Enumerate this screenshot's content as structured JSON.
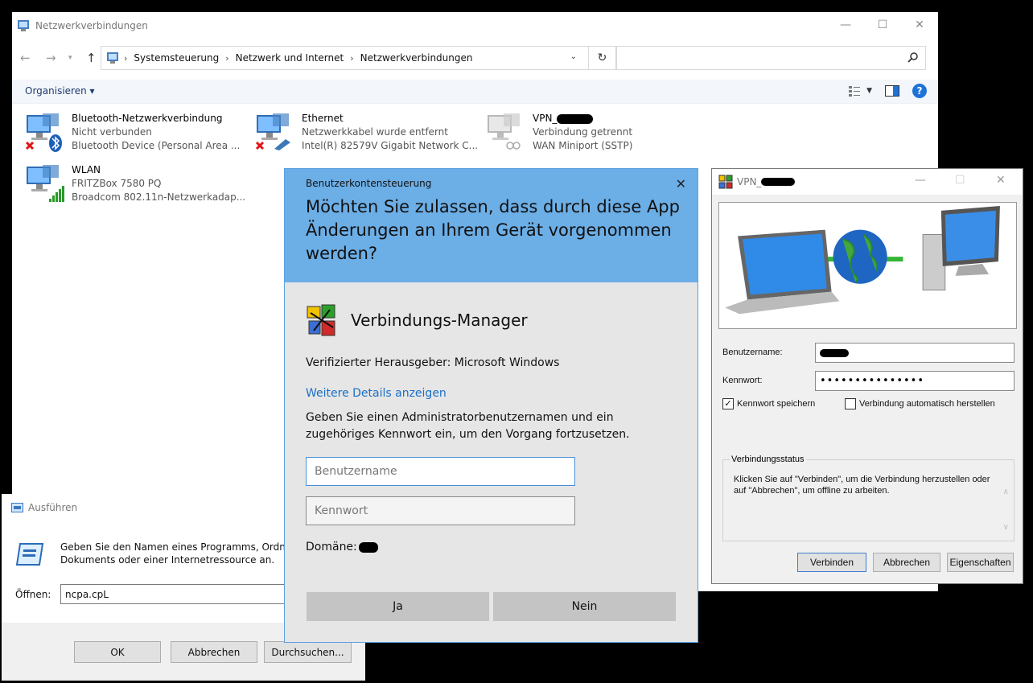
{
  "explorer": {
    "title": "Netzwerkverbindungen",
    "breadcrumbs": [
      "Systemsteuerung",
      "Netzwerk und Internet",
      "Netzwerkverbindungen"
    ],
    "search_placeholder": "",
    "organize_label": "Organisieren ▾",
    "connections": [
      {
        "name": "Bluetooth-Netzwerkverbindung",
        "status": "Nicht verbunden",
        "device": "Bluetooth Device (Personal Area ..."
      },
      {
        "name": "Ethernet",
        "status": "Netzwerkkabel wurde entfernt",
        "device": "Intel(R) 82579V Gigabit Network C..."
      },
      {
        "name": "VPN_",
        "status": "Verbindung getrennt",
        "device": "WAN Miniport (SSTP)"
      },
      {
        "name": "WLAN",
        "status": "FRITZBox 7580 PQ",
        "device": "Broadcom 802.11n-Netzwerkadap..."
      }
    ]
  },
  "uac": {
    "label": "Benutzerkontensteuerung",
    "question": "Möchten Sie zulassen, dass durch diese App Änderungen an Ihrem Gerät vorgenommen werden?",
    "app_name": "Verbindungs-Manager",
    "publisher": "Verifizierter Herausgeber: Microsoft Windows",
    "more_details": "Weitere Details anzeigen",
    "description": "Geben Sie einen Administratorbenutzernamen und ein zugehöriges Kennwort ein, um den Vorgang fortzusetzen.",
    "username_placeholder": "Benutzername",
    "password_placeholder": "Kennwort",
    "domain_label": "Domäne:",
    "yes_label": "Ja",
    "no_label": "Nein"
  },
  "run": {
    "title": "Ausführen",
    "description_line1": "Geben Sie den Namen eines Programms, Ordn",
    "description_line2": "Dokuments oder einer Internetressource an.",
    "open_label": "Öffnen:",
    "open_value": "ncpa.cpL",
    "ok_label": "OK",
    "cancel_label": "Abbrechen",
    "browse_label": "Durchsuchen..."
  },
  "vpn": {
    "title": "VPN_",
    "username_label": "Benutzername:",
    "password_label": "Kennwort:",
    "password_value": "•••••••••••••••",
    "save_password_label": "Kennwort speichern",
    "auto_connect_label": "Verbindung automatisch herstellen",
    "status_group_label": "Verbindungsstatus",
    "status_text": "Klicken Sie auf \"Verbinden\", um die Verbindung herzustellen oder auf \"Abbrechen\", um offline zu arbeiten.",
    "connect_label": "Verbinden",
    "cancel_label": "Abbrechen",
    "properties_label": "Eigenschaften"
  }
}
